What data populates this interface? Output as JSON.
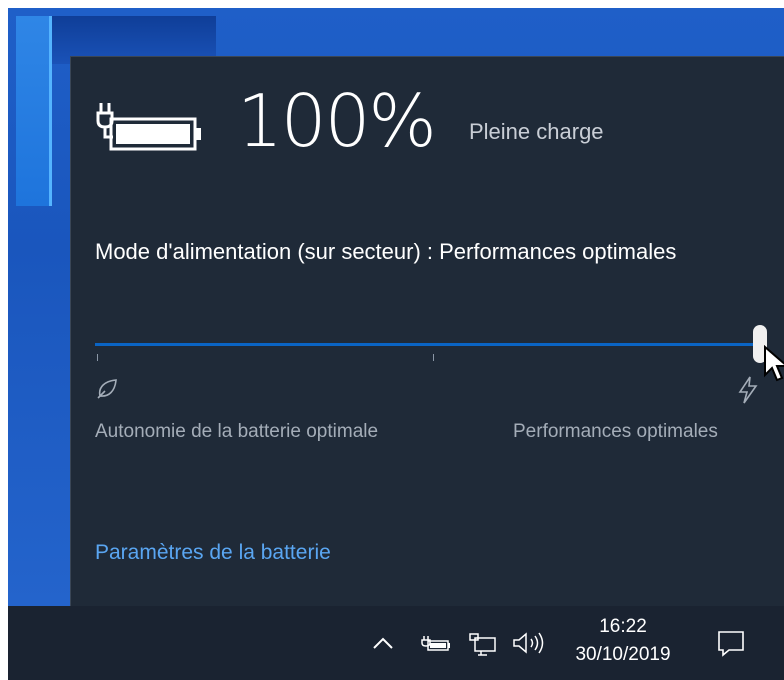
{
  "battery": {
    "percent_text": "100%",
    "status": "Pleine charge",
    "level": 1.0
  },
  "power_mode": {
    "label": "Mode d'alimentation (sur secteur) : Performances optimales",
    "slider_value_fraction": 1.0,
    "left_label": "Autonomie de la batterie optimale",
    "right_label": "Performances optimales",
    "left_icon": "leaf-icon",
    "right_icon": "lightning-bolt-icon"
  },
  "settings_link": "Paramètres de la batterie",
  "taskbar": {
    "tray_icons": [
      "chevron-up-icon",
      "battery-plugged-icon",
      "network-icon",
      "volume-icon"
    ],
    "time": "16:22",
    "date": "30/10/2019",
    "notification_icon": "action-center-icon"
  },
  "colors": {
    "flyout_bg": "#1f2a38",
    "accent": "#0a64c4",
    "link": "#5aa6f2",
    "taskbar_bg": "#1a2331"
  }
}
